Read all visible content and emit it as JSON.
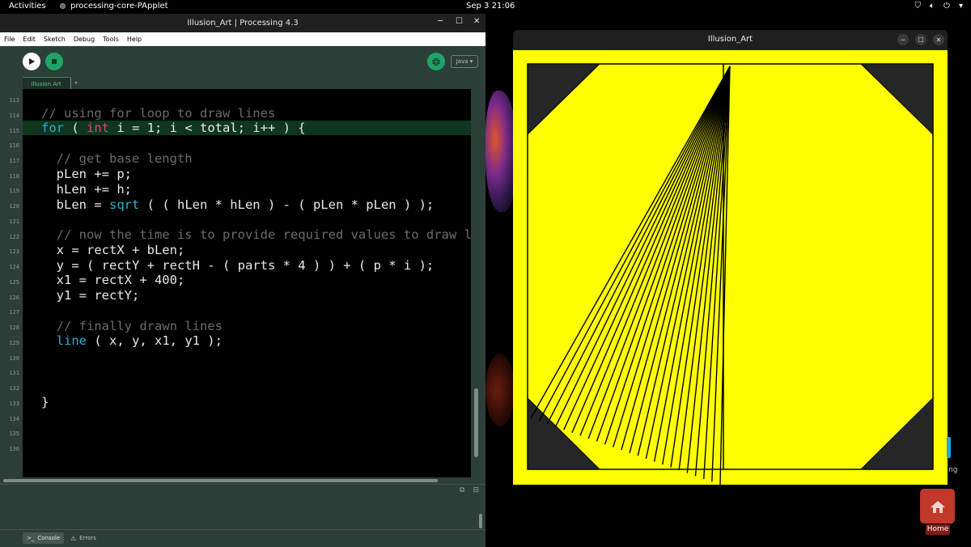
{
  "topbar": {
    "activities": "Activities",
    "app_name": "processing-core-PApplet",
    "clock": "Sep 3  21:06",
    "tray_icons": [
      "network-icon",
      "volume-icon",
      "power-icon",
      "chevron-down-icon"
    ]
  },
  "ide": {
    "title": "Illusion_Art | Processing 4.3",
    "menu": [
      "File",
      "Edit",
      "Sketch",
      "Debug",
      "Tools",
      "Help"
    ],
    "mode": "Java",
    "tab": "Illusion Art",
    "line_numbers": [
      "113",
      "114",
      "115",
      "116",
      "117",
      "118",
      "119",
      "120",
      "121",
      "122",
      "123",
      "124",
      "125",
      "126",
      "127",
      "128",
      "129",
      "130",
      "131",
      "132",
      "133",
      "134",
      "135",
      "136"
    ],
    "console_label": "Console",
    "errors_label": "Errors"
  },
  "sketch": {
    "title": "Illusion_Art",
    "colors": {
      "background": "#ffff00",
      "corner": "#262626",
      "stroke": "#000000"
    }
  },
  "dock": {
    "home_label": "Home"
  }
}
